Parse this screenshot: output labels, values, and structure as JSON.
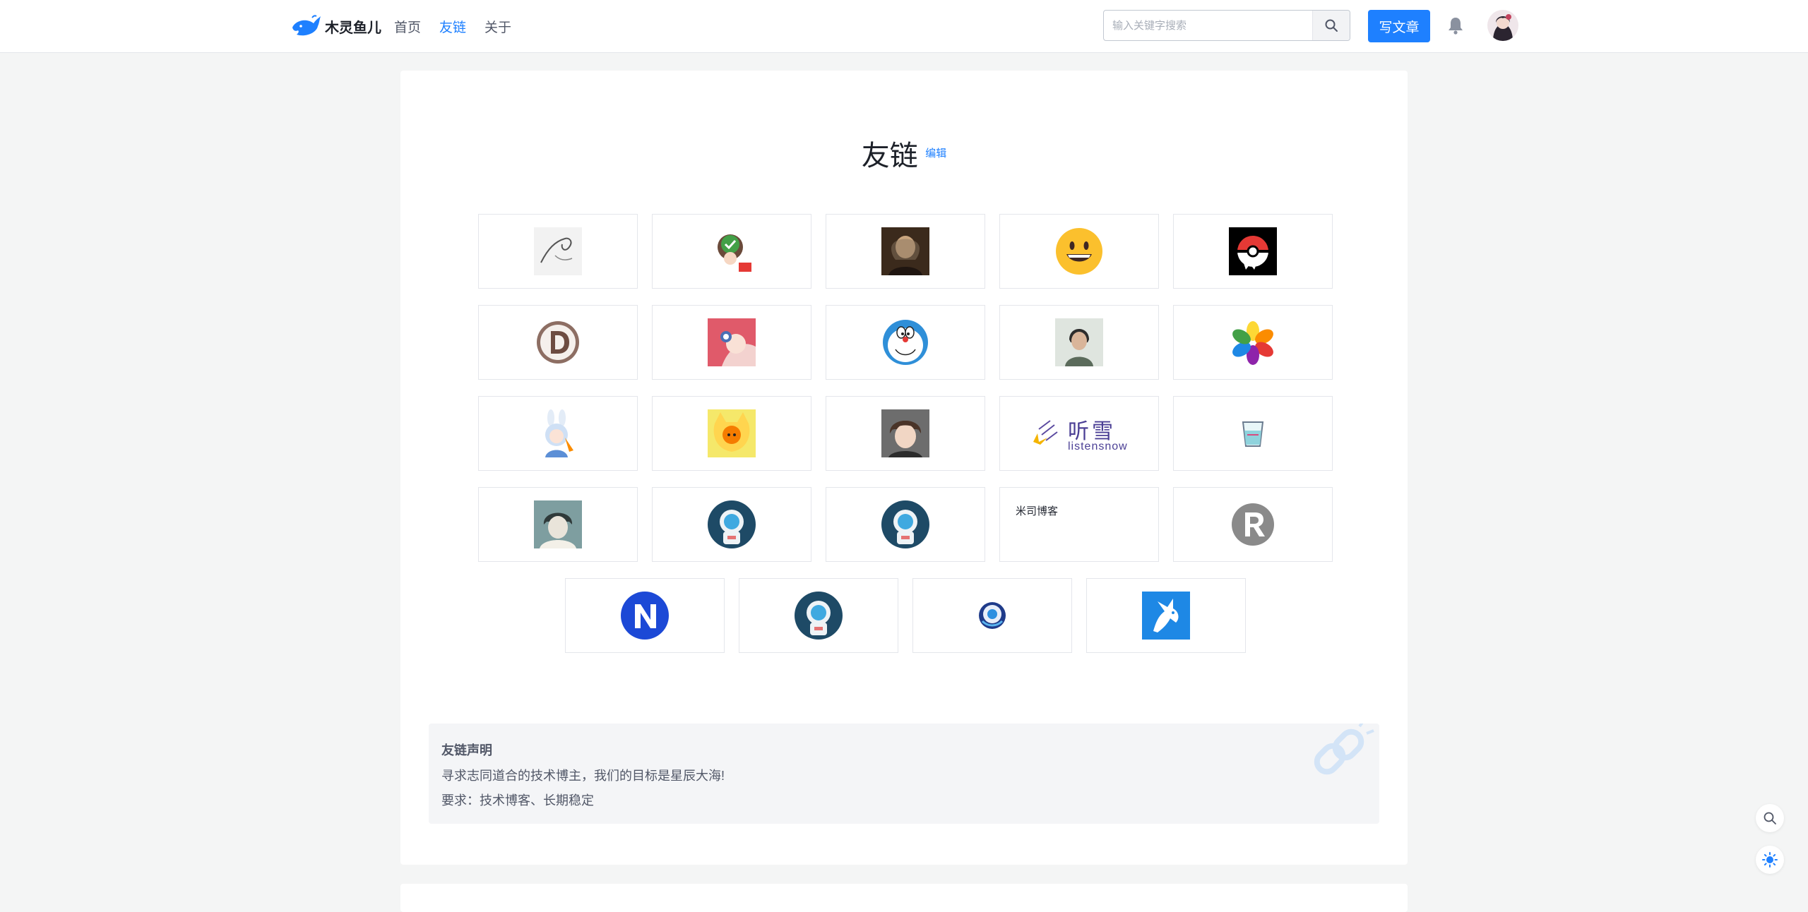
{
  "header": {
    "logo_text": "木灵鱼儿",
    "nav": [
      {
        "label": "首页",
        "active": false
      },
      {
        "label": "友链",
        "active": true
      },
      {
        "label": "关于",
        "active": false
      }
    ],
    "search_placeholder": "输入关键字搜索",
    "write_button": "写文章"
  },
  "page": {
    "title": "友链",
    "edit_label": "编辑"
  },
  "friend_links": [
    {
      "icon": "ink-sketch-avatar"
    },
    {
      "icon": "anime-girl-checkmark-avatar"
    },
    {
      "icon": "portrait-painting-avatar"
    },
    {
      "icon": "grinning-emoji-avatar"
    },
    {
      "icon": "pokeball-ghost-avatar"
    },
    {
      "icon": "letter-d-logo-avatar"
    },
    {
      "icon": "anime-pink-hair-avatar"
    },
    {
      "icon": "doraemon-avatar"
    },
    {
      "icon": "man-portrait-avatar"
    },
    {
      "icon": "colorful-flower-logo-avatar"
    },
    {
      "icon": "bunny-girl-avatar"
    },
    {
      "icon": "yellow-cat-avatar"
    },
    {
      "icon": "anime-boy-avatar"
    },
    {
      "icon": "listensnow-logo",
      "title": "听雪",
      "subtitle": "listensnow"
    },
    {
      "icon": "cup-icon-avatar"
    },
    {
      "icon": "sketch-girl-avatar"
    },
    {
      "icon": "astronaut-avatar"
    },
    {
      "icon": "astronaut-avatar"
    },
    {
      "icon": "text-only",
      "text": "米司博客"
    },
    {
      "icon": "letter-r-logo-avatar"
    },
    {
      "icon": "letter-n-logo-avatar"
    },
    {
      "icon": "astronaut-avatar"
    },
    {
      "icon": "blue-eye-logo-avatar"
    },
    {
      "icon": "blue-dragon-logo-avatar"
    }
  ],
  "notice": {
    "title": "友链声明",
    "line1": "寻求志同道合的技术博主，我们的目标是星辰大海!",
    "line2": "要求：技术博客、长期稳定"
  },
  "colors": {
    "accent": "#1e80ff",
    "background": "#f4f5f5",
    "card": "#ffffff",
    "notice_bg": "#f4f5f7"
  }
}
